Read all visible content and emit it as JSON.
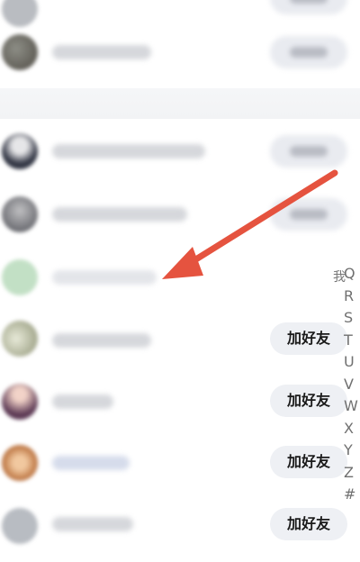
{
  "rows": [
    {
      "button_label": ""
    },
    {
      "button_label": ""
    },
    {
      "button_label": ""
    },
    {
      "button_label": ""
    },
    {
      "button_label": "加好友"
    },
    {
      "button_label": "加好友"
    },
    {
      "button_label": "加好友"
    },
    {
      "button_label": "加好友"
    }
  ],
  "side_glyph": "我",
  "index_letters": [
    "Q",
    "R",
    "S",
    "T",
    "U",
    "V",
    "W",
    "X",
    "Y",
    "Z",
    "#"
  ],
  "colors": {
    "arrow": "#e5533f",
    "button_bg": "#eef0f4"
  }
}
